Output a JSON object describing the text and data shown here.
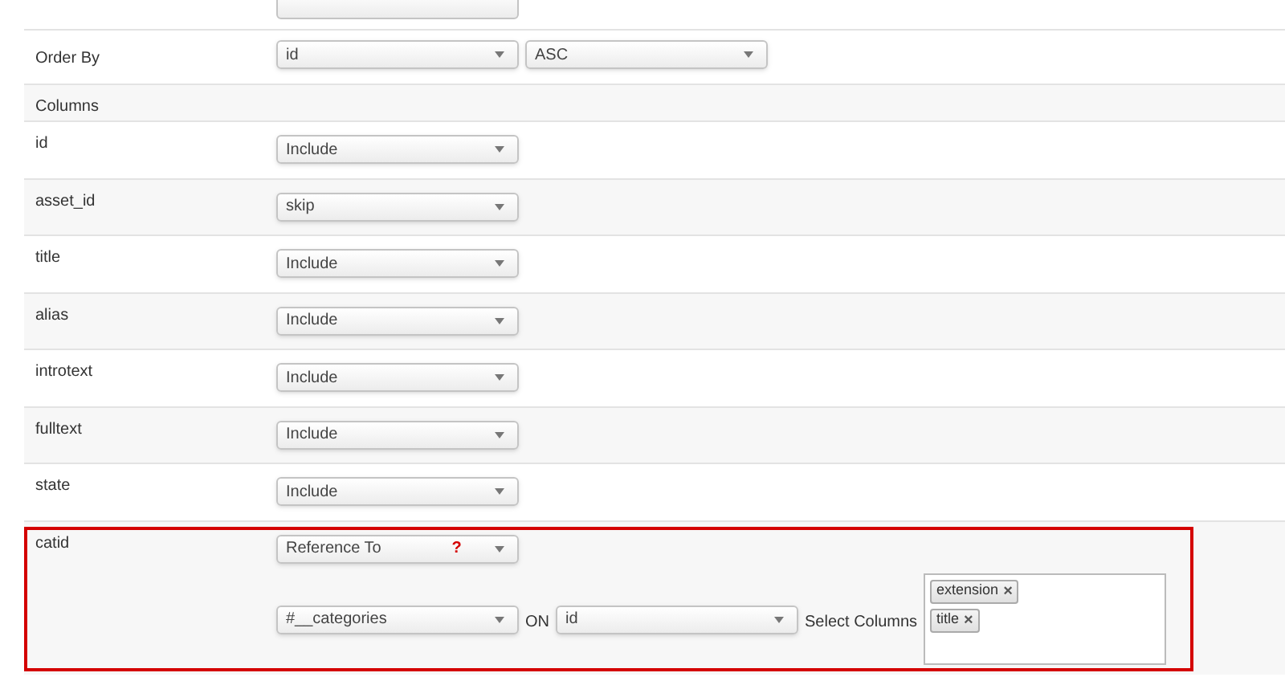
{
  "order_by": {
    "label": "Order By",
    "field": "id",
    "direction": "ASC"
  },
  "columns_heading": "Columns",
  "columns": [
    {
      "name": "id",
      "action": "Include"
    },
    {
      "name": "asset_id",
      "action": "skip"
    },
    {
      "name": "title",
      "action": "Include"
    },
    {
      "name": "alias",
      "action": "Include"
    },
    {
      "name": "introtext",
      "action": "Include"
    },
    {
      "name": "fulltext",
      "action": "Include"
    },
    {
      "name": "state",
      "action": "Include"
    }
  ],
  "reference": {
    "name": "catid",
    "action": "Reference To",
    "help_mark": "?",
    "highlighted": true,
    "table": "#__categories",
    "on_label": "ON",
    "on_column": "id",
    "select_label": "Select Columns",
    "selected_columns": [
      {
        "label": "extension",
        "remove": "×"
      },
      {
        "label": "title",
        "remove": "×"
      }
    ]
  }
}
